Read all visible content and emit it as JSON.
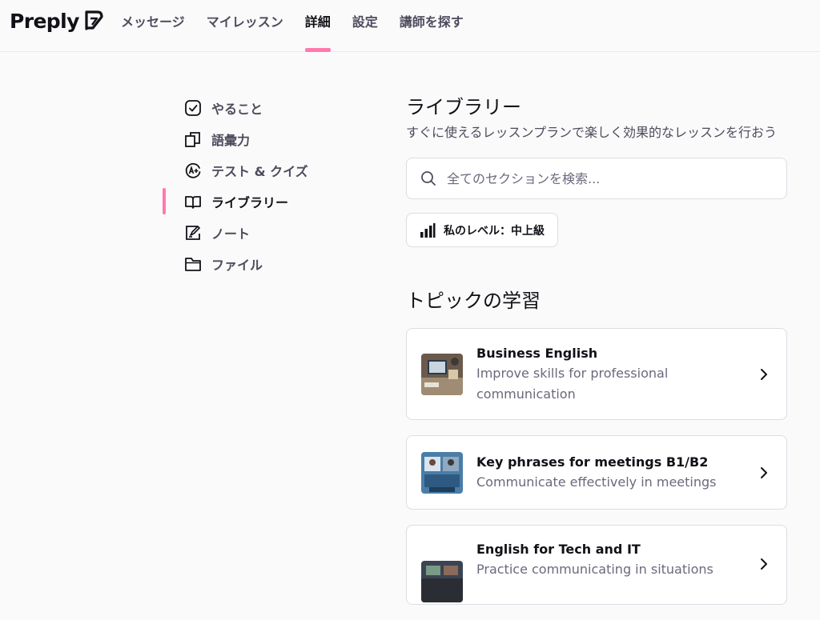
{
  "brand": {
    "name": "Preply"
  },
  "nav": {
    "items": [
      {
        "label": "メッセージ"
      },
      {
        "label": "マイレッスン"
      },
      {
        "label": "詳細",
        "active": true
      },
      {
        "label": "設定"
      },
      {
        "label": "講師を探す"
      }
    ],
    "accent_color": "#ff7aac"
  },
  "sidebar": {
    "items": [
      {
        "label": "やること",
        "icon": "checkbox-icon"
      },
      {
        "label": "語彙力",
        "icon": "cards-icon"
      },
      {
        "label": "テスト & クイズ",
        "icon": "grade-icon"
      },
      {
        "label": "ライブラリー",
        "icon": "book-icon",
        "active": true
      },
      {
        "label": "ノート",
        "icon": "note-icon"
      },
      {
        "label": "ファイル",
        "icon": "folder-icon"
      }
    ]
  },
  "main": {
    "title": "ライブラリー",
    "subtitle": "すぐに使えるレッスンプランで楽しく効果的なレッスンを行おう",
    "search_placeholder": "全てのセクションを検索...",
    "level_label": "私のレベル：中上級",
    "section_title": "トピックの学習",
    "topics": [
      {
        "title": "Business English",
        "description": "Improve skills for professional communication"
      },
      {
        "title": "Key phrases for meetings B1/B2",
        "description": "Communicate effectively in meetings"
      },
      {
        "title": "English for Tech and IT",
        "description": "Practice communicating in situations"
      }
    ]
  }
}
